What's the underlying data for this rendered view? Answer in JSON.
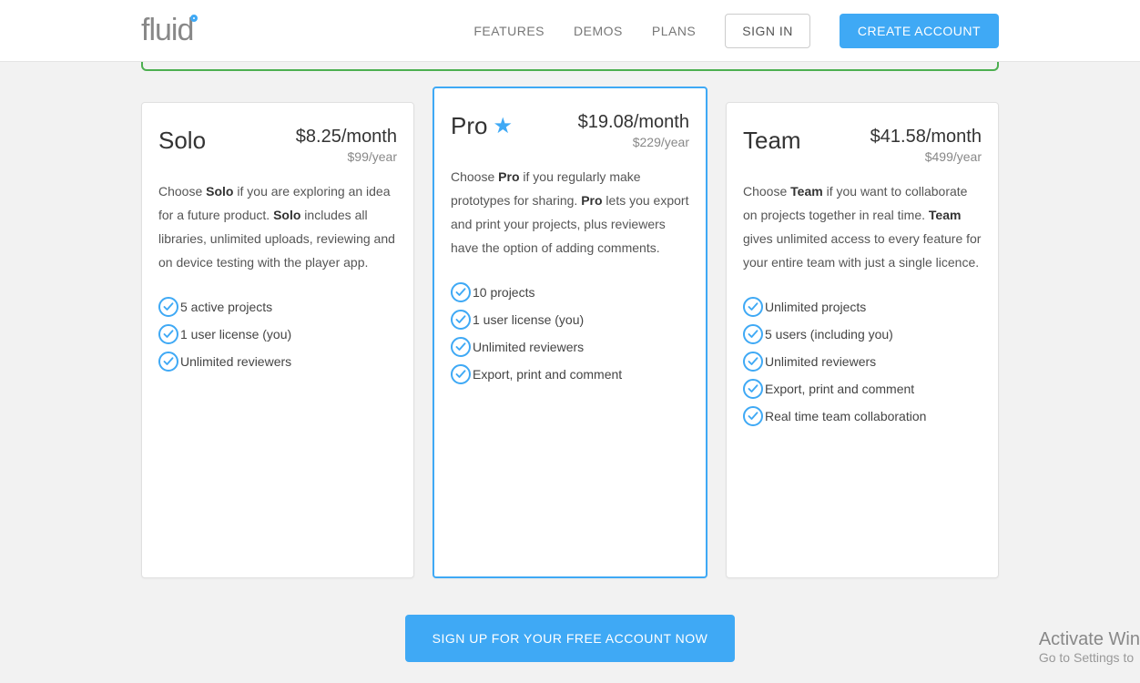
{
  "header": {
    "logo_text": "fluid",
    "nav": {
      "features": "FEATURES",
      "demos": "DEMOS",
      "plans": "PLANS"
    },
    "signin": "SIGN IN",
    "create": "CREATE ACCOUNT"
  },
  "plans": {
    "solo": {
      "name": "Solo",
      "price_month": "$8.25/month",
      "price_year": "$99/year",
      "desc_prefix": "Choose ",
      "desc_b1": "Solo",
      "desc_mid": " if you are exploring an idea for a future product. ",
      "desc_b2": "Solo",
      "desc_suffix": " includes all libraries, unlimited uploads, reviewing and on device testing with the player app.",
      "features": [
        "5 active projects",
        "1 user license (you)",
        "Unlimited reviewers"
      ]
    },
    "pro": {
      "name": "Pro",
      "price_month": "$19.08/month",
      "price_year": "$229/year",
      "desc_prefix": "Choose ",
      "desc_b1": "Pro",
      "desc_mid": " if you regularly make prototypes for sharing. ",
      "desc_b2": "Pro",
      "desc_suffix": " lets you export and print your projects, plus reviewers have the option of adding comments.",
      "features": [
        "10 projects",
        "1 user license (you)",
        "Unlimited reviewers",
        "Export, print and comment"
      ]
    },
    "team": {
      "name": "Team",
      "price_month": "$41.58/month",
      "price_year": "$499/year",
      "desc_prefix": "Choose ",
      "desc_b1": "Team",
      "desc_mid": " if you want to collaborate on projects together in real time. ",
      "desc_b2": "Team",
      "desc_suffix": " gives unlimited access to every feature for your entire team with just a single licence.",
      "features": [
        "Unlimited projects",
        "5 users (including you)",
        "Unlimited reviewers",
        "Export, print and comment",
        "Real time team collaboration"
      ]
    }
  },
  "cta": "SIGN UP FOR YOUR FREE ACCOUNT NOW",
  "watermark": {
    "title": "Activate Win",
    "sub": "Go to Settings to"
  }
}
